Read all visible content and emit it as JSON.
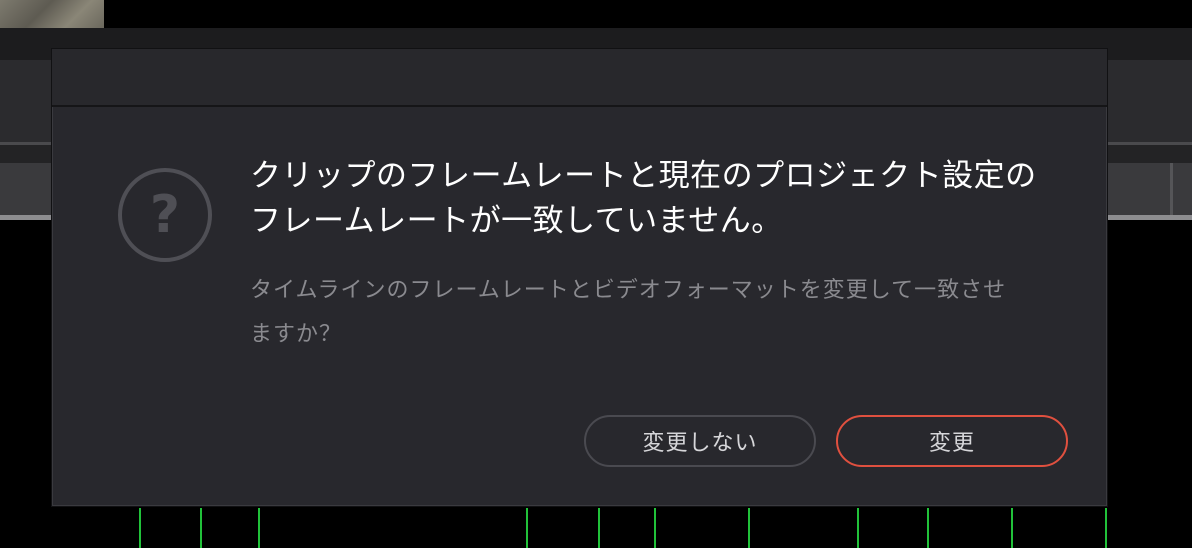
{
  "dialog": {
    "headline_line1": "クリップのフレームレートと現在のプロジェクト設定の",
    "headline_line2": "フレームレートが一致していません。",
    "message_line1": "タイムラインのフレームレートとビデオフォーマットを変更して一致させ",
    "message_line2": "ますか？",
    "icon": "question-circle-icon",
    "buttons": {
      "cancel_label": "変更しない",
      "confirm_label": "変更"
    }
  },
  "colors": {
    "dialog_background": "#28282d",
    "confirm_accent": "#e0503f",
    "timeline_marker": "#21c23a",
    "icon_stroke": "#4f4f55"
  }
}
